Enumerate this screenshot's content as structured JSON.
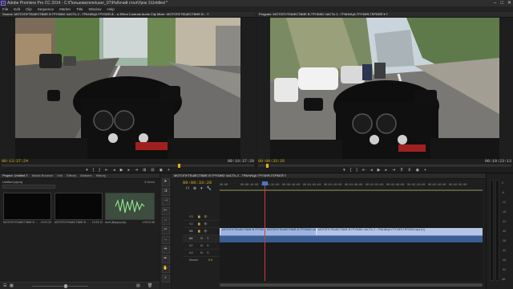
{
  "app": {
    "title": "Adobe Premiere Pro CC 2014 - C:\\Пользователи\\user_07\\Рабочий стол\\Урок 1\\Untitled *",
    "icon": "Pr"
  },
  "window_controls": {
    "minimize": "–",
    "maximize": "□",
    "close": "✕"
  },
  "menu": [
    "File",
    "Edit",
    "Clip",
    "Sequence",
    "Marker",
    "Title",
    "Window",
    "Help"
  ],
  "source_monitor": {
    "header": "Source: МОТОПУТЕШЕСТВИЕ В ГРУЗИЮ ЧАСТЬ 2 - ГРАНИЦА ГРУЗИЯ-Ф... ▸ Effect Controls   Audio Clip Mixer: МОТОПУТЕШЕСТВИЕ В...  ≡",
    "timecode_in": "00:13:37:24",
    "timecode_duration": "00:19:37:20"
  },
  "program_monitor": {
    "header": "Program: МОТОПУТЕШЕСТВИЕ В ГРУЗИЮ ЧАСТЬ 2 - ГРАНИЦА ГРУЗИЯ-ГЕРБЕЙ ▾  ≡",
    "timecode_in": "00:00:33:26",
    "timecode_duration": "00:19:23:13"
  },
  "transport_icons": [
    "marker-icon",
    "in-point-icon",
    "out-point-icon",
    "go-to-in-icon",
    "step-back-icon",
    "play-icon",
    "step-forward-icon",
    "go-to-out-icon",
    "insert-icon",
    "overwrite-icon",
    "export-frame-icon",
    "add-icon"
  ],
  "project_panel": {
    "tabs": [
      "Project: Untitled ≡",
      "Media Browser",
      "Info",
      "Effects",
      "Markers",
      "History"
    ],
    "project_name": "Untitled.prproj",
    "item_count": "3 Items",
    "items": [
      {
        "name": "МОТОПУТЕШЕСТВИЕ В ...",
        "duration": "19:37:20"
      },
      {
        "name": "МОТОПУТЕШЕСТВИЕ В ...",
        "duration": "19:23:13"
      },
      {
        "name": "Audi (Вирусу.mp)",
        "duration": "1:39:11:56"
      }
    ]
  },
  "timeline": {
    "tab": "МОТОПУТЕШЕСТВИЕ В ГРУЗИЮ ЧАСТЬ 2 - ГРАНИЦА ГРУЗИЯ-ГЕРБЕЙ  ≡",
    "timecode": "00:00:33:26",
    "ruler": [
      "00:00",
      "00:00:16:00",
      "00:00:32:00",
      "00:00:48:00",
      "00:01:04:00",
      "00:01:20:00",
      "00:01:36:00",
      "00:01:52:00",
      "00:02:08:00",
      "00:02:24:00",
      "00:02:40:00",
      "00:02:56:00"
    ],
    "tracks": {
      "video": [
        "V3",
        "V2",
        "V1"
      ],
      "audio": [
        "A1",
        "A2",
        "A3"
      ],
      "master": "Master",
      "master_value": "0.0"
    },
    "clips": {
      "v1_a": "МОТОПУТЕШЕСТВИЕ В ГРУЗИ",
      "v1_b": "МОТОПУТЕШЕСТВИЕ В ГРУЗИЮ ЧА",
      "v1_c": "МОТОПУТЕШЕСТВИЕ В ГРУЗИЮ ЧАСТЬ 2 - ГРАНИЦА ГРУЗИЯ-ГЕРБЕЙ.mp4 [V]"
    },
    "track_controls": {
      "lock": "🔒",
      "eye": "👁",
      "mute": "M",
      "solo": "S"
    }
  },
  "tools": [
    "selection-tool-icon",
    "track-select-tool-icon",
    "ripple-edit-tool-icon",
    "rolling-edit-tool-icon",
    "rate-stretch-tool-icon",
    "razor-tool-icon",
    "slip-tool-icon",
    "slide-tool-icon",
    "pen-tool-icon",
    "hand-tool-icon",
    "zoom-tool-icon"
  ],
  "audio_meter": {
    "scale": [
      "0",
      "-6",
      "-12",
      "-18",
      "-24",
      "-30",
      "-36",
      "-42",
      "-48",
      "-54",
      "dB"
    ]
  },
  "colors": {
    "accent_timecode": "#e2b21c",
    "video_clip": "#9fb4de",
    "audio_clip": "#3a5e93",
    "playhead": "#d03a3a"
  }
}
